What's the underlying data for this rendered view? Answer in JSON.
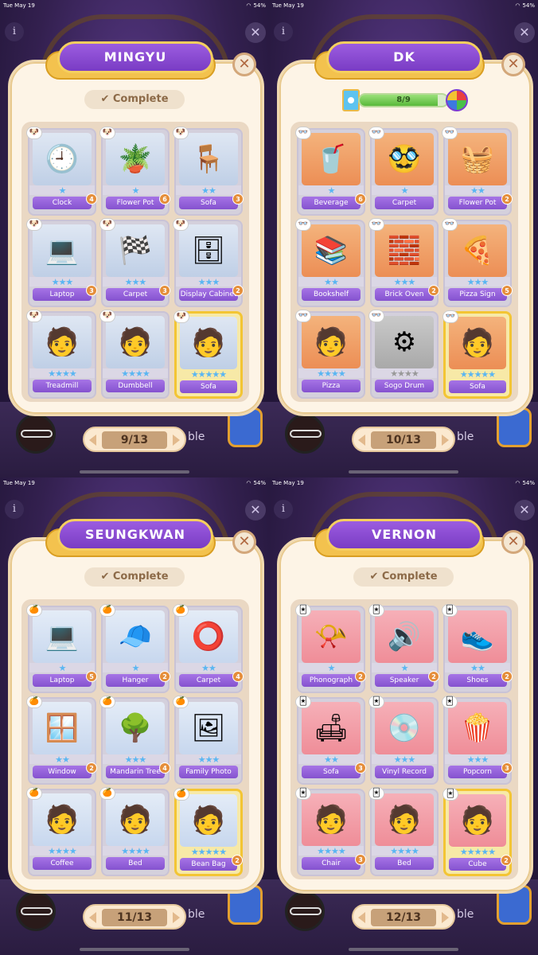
{
  "status_bar": {
    "time": "Tue May 19",
    "battery": "54%"
  },
  "complete_label": "Complete",
  "complete_check": "✔",
  "side_text": "ble",
  "panels": [
    {
      "title": "MINGYU",
      "theme": "mingyu",
      "header": "complete",
      "page": "9/13",
      "badge": "🐶",
      "cards": [
        {
          "label": "Clock",
          "stars": 1,
          "count": "4",
          "icon": "clock-icon",
          "glyph": "🕘"
        },
        {
          "label": "Flower Pot",
          "stars": 1,
          "count": "6",
          "icon": "flower-pot-icon",
          "glyph": "🪴"
        },
        {
          "label": "Sofa",
          "stars": 2,
          "count": "3",
          "icon": "sofa-icon",
          "glyph": "🪑"
        },
        {
          "label": "Laptop",
          "stars": 3,
          "count": "3",
          "icon": "laptop-icon",
          "glyph": "💻"
        },
        {
          "label": "Carpet",
          "stars": 3,
          "count": "3",
          "icon": "checkered-carpet-icon",
          "glyph": "🏁"
        },
        {
          "label": "Display Cabinet",
          "stars": 3,
          "count": "2",
          "icon": "display-cabinet-icon",
          "glyph": "🗄"
        },
        {
          "label": "Treadmill",
          "stars": 4,
          "count": "",
          "icon": "character-treadmill-icon",
          "glyph": "🧑"
        },
        {
          "label": "Dumbbell",
          "stars": 4,
          "count": "",
          "icon": "character-dumbbell-icon",
          "glyph": "🧑"
        },
        {
          "label": "Sofa",
          "stars": 5,
          "count": "",
          "icon": "character-sofa-icon",
          "glyph": "🧑",
          "gold": true
        }
      ]
    },
    {
      "title": "DK",
      "theme": "dk",
      "header": "progress",
      "page": "10/13",
      "badge": "👓",
      "progress": {
        "current": 8,
        "total": 9,
        "text": "8/9"
      },
      "cards": [
        {
          "label": "Beverage",
          "stars": 1,
          "count": "6",
          "icon": "beverage-icon",
          "glyph": "🥤"
        },
        {
          "label": "Carpet",
          "stars": 1,
          "count": "",
          "icon": "salute-carpet-icon",
          "glyph": "🥸"
        },
        {
          "label": "Flower Pot",
          "stars": 2,
          "count": "2",
          "icon": "hanging-pot-icon",
          "glyph": "🧺"
        },
        {
          "label": "Bookshelf",
          "stars": 2,
          "count": "",
          "icon": "bookshelf-icon",
          "glyph": "📚"
        },
        {
          "label": "Brick Oven",
          "stars": 3,
          "count": "2",
          "icon": "brick-oven-icon",
          "glyph": "🧱"
        },
        {
          "label": "Pizza Sign",
          "stars": 3,
          "count": "5",
          "icon": "pizza-sign-icon",
          "glyph": "🍕"
        },
        {
          "label": "Pizza",
          "stars": 4,
          "count": "",
          "icon": "character-pizza-icon",
          "glyph": "🧑"
        },
        {
          "label": "Sogo Drum",
          "stars": 4,
          "count": "",
          "icon": "locked-gear-icon",
          "glyph": "⚙",
          "grey": true
        },
        {
          "label": "Sofa",
          "stars": 5,
          "count": "",
          "icon": "character-sofa-icon",
          "glyph": "🧑",
          "gold": true
        }
      ]
    },
    {
      "title": "SEUNGKWAN",
      "theme": "seungkwan",
      "header": "complete",
      "page": "11/13",
      "badge": "🍊",
      "cards": [
        {
          "label": "Laptop",
          "stars": 1,
          "count": "5",
          "icon": "laptop-icon",
          "glyph": "💻"
        },
        {
          "label": "Hanger",
          "stars": 1,
          "count": "2",
          "icon": "hanger-icon",
          "glyph": "🧢"
        },
        {
          "label": "Carpet",
          "stars": 2,
          "count": "4",
          "icon": "round-carpet-icon",
          "glyph": "⭕"
        },
        {
          "label": "Window",
          "stars": 2,
          "count": "2",
          "icon": "window-icon",
          "glyph": "🪟"
        },
        {
          "label": "Mandarin Tree",
          "stars": 3,
          "count": "4",
          "icon": "mandarin-tree-icon",
          "glyph": "🌳"
        },
        {
          "label": "Family Photo",
          "stars": 3,
          "count": "",
          "icon": "family-photo-icon",
          "glyph": "🖼"
        },
        {
          "label": "Coffee",
          "stars": 4,
          "count": "",
          "icon": "character-coffee-icon",
          "glyph": "🧑"
        },
        {
          "label": "Bed",
          "stars": 4,
          "count": "",
          "icon": "character-bed-icon",
          "glyph": "🧑"
        },
        {
          "label": "Bean Bag",
          "stars": 5,
          "count": "2",
          "icon": "character-bean-bag-icon",
          "glyph": "🧑",
          "gold": true
        }
      ]
    },
    {
      "title": "VERNON",
      "theme": "vernon",
      "header": "complete",
      "page": "12/13",
      "badge": "🃏",
      "cards": [
        {
          "label": "Phonograph",
          "stars": 1,
          "count": "2",
          "icon": "phonograph-icon",
          "glyph": "📯"
        },
        {
          "label": "Speaker",
          "stars": 1,
          "count": "2",
          "icon": "speaker-icon",
          "glyph": "🔊"
        },
        {
          "label": "Shoes",
          "stars": 2,
          "count": "2",
          "icon": "shoes-icon",
          "glyph": "👟"
        },
        {
          "label": "Sofa",
          "stars": 2,
          "count": "3",
          "icon": "yellow-sofa-icon",
          "glyph": "🛋"
        },
        {
          "label": "Vinyl Record",
          "stars": 3,
          "count": "",
          "icon": "vinyl-record-icon",
          "glyph": "💿"
        },
        {
          "label": "Popcorn",
          "stars": 3,
          "count": "3",
          "icon": "popcorn-icon",
          "glyph": "🍿"
        },
        {
          "label": "Chair",
          "stars": 4,
          "count": "3",
          "icon": "character-chair-icon",
          "glyph": "🧑"
        },
        {
          "label": "Bed",
          "stars": 4,
          "count": "",
          "icon": "character-bed-icon",
          "glyph": "🧑"
        },
        {
          "label": "Cube",
          "stars": 5,
          "count": "2",
          "icon": "character-cube-icon",
          "glyph": "🧑",
          "gold": true
        }
      ]
    }
  ]
}
